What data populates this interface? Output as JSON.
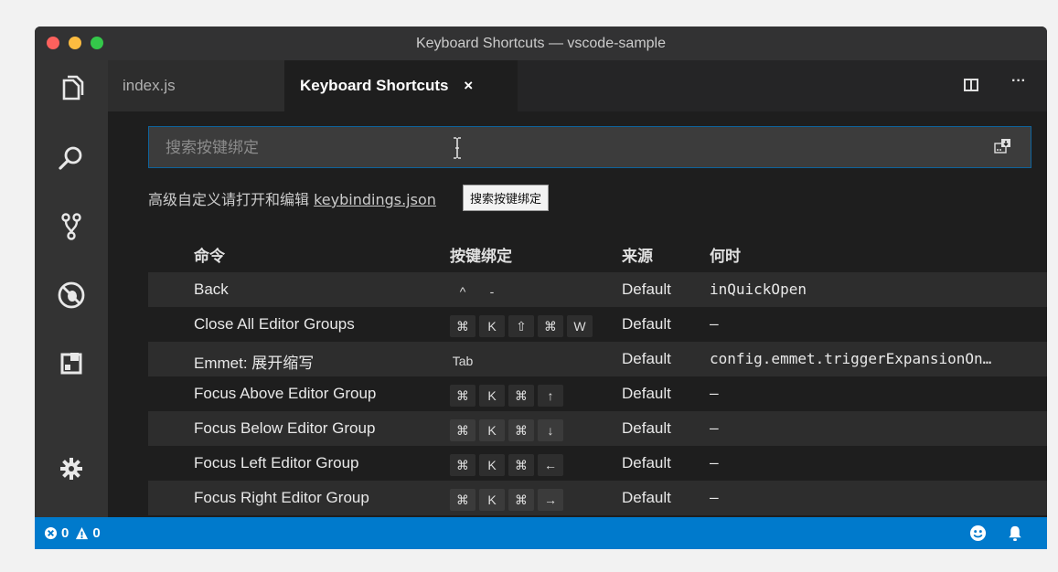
{
  "window": {
    "title": "Keyboard Shortcuts — vscode-sample"
  },
  "activity_bar": {
    "icons": [
      "files-icon",
      "search-icon",
      "source-control-icon",
      "debug-icon",
      "extensions-icon",
      "settings-gear-icon"
    ]
  },
  "tabs": [
    {
      "label": "index.js",
      "active": false
    },
    {
      "label": "Keyboard Shortcuts",
      "active": true,
      "close": "×"
    }
  ],
  "editor_actions": {
    "split": "split-editor-icon",
    "more": "···"
  },
  "search": {
    "placeholder": "搜索按键绑定"
  },
  "hint": {
    "text": "高级自定义请打开和编辑 ",
    "link": "keybindings.json"
  },
  "tooltip": {
    "text": "搜索按键绑定"
  },
  "table": {
    "headers": {
      "command": "命令",
      "keybinding": "按键绑定",
      "source": "来源",
      "when": "何时"
    },
    "rows": [
      {
        "command": "Back",
        "keys": [
          "^",
          "-"
        ],
        "source": "Default",
        "when": "inQuickOpen"
      },
      {
        "command": "Close All Editor Groups",
        "keys": [
          "⌘",
          "K",
          "⇧",
          "⌘",
          "W"
        ],
        "source": "Default",
        "when": "—"
      },
      {
        "command": "Emmet: 展开缩写",
        "keys": [
          "Tab"
        ],
        "source": "Default",
        "when": "config.emmet.triggerExpansionOn…"
      },
      {
        "command": "Focus Above Editor Group",
        "keys": [
          "⌘",
          "K",
          "⌘",
          "↑"
        ],
        "source": "Default",
        "when": "—"
      },
      {
        "command": "Focus Below Editor Group",
        "keys": [
          "⌘",
          "K",
          "⌘",
          "↓"
        ],
        "source": "Default",
        "when": "—"
      },
      {
        "command": "Focus Left Editor Group",
        "keys": [
          "⌘",
          "K",
          "⌘",
          "←"
        ],
        "source": "Default",
        "when": "—"
      },
      {
        "command": "Focus Right Editor Group",
        "keys": [
          "⌘",
          "K",
          "⌘",
          "→"
        ],
        "source": "Default",
        "when": "—"
      }
    ]
  },
  "status_bar": {
    "errors": "0",
    "warnings": "0"
  },
  "colors": {
    "status": "#007acc",
    "focus_border": "#0e639c",
    "red": "#fc615d",
    "yellow": "#fdbc40",
    "green": "#34c84a"
  }
}
